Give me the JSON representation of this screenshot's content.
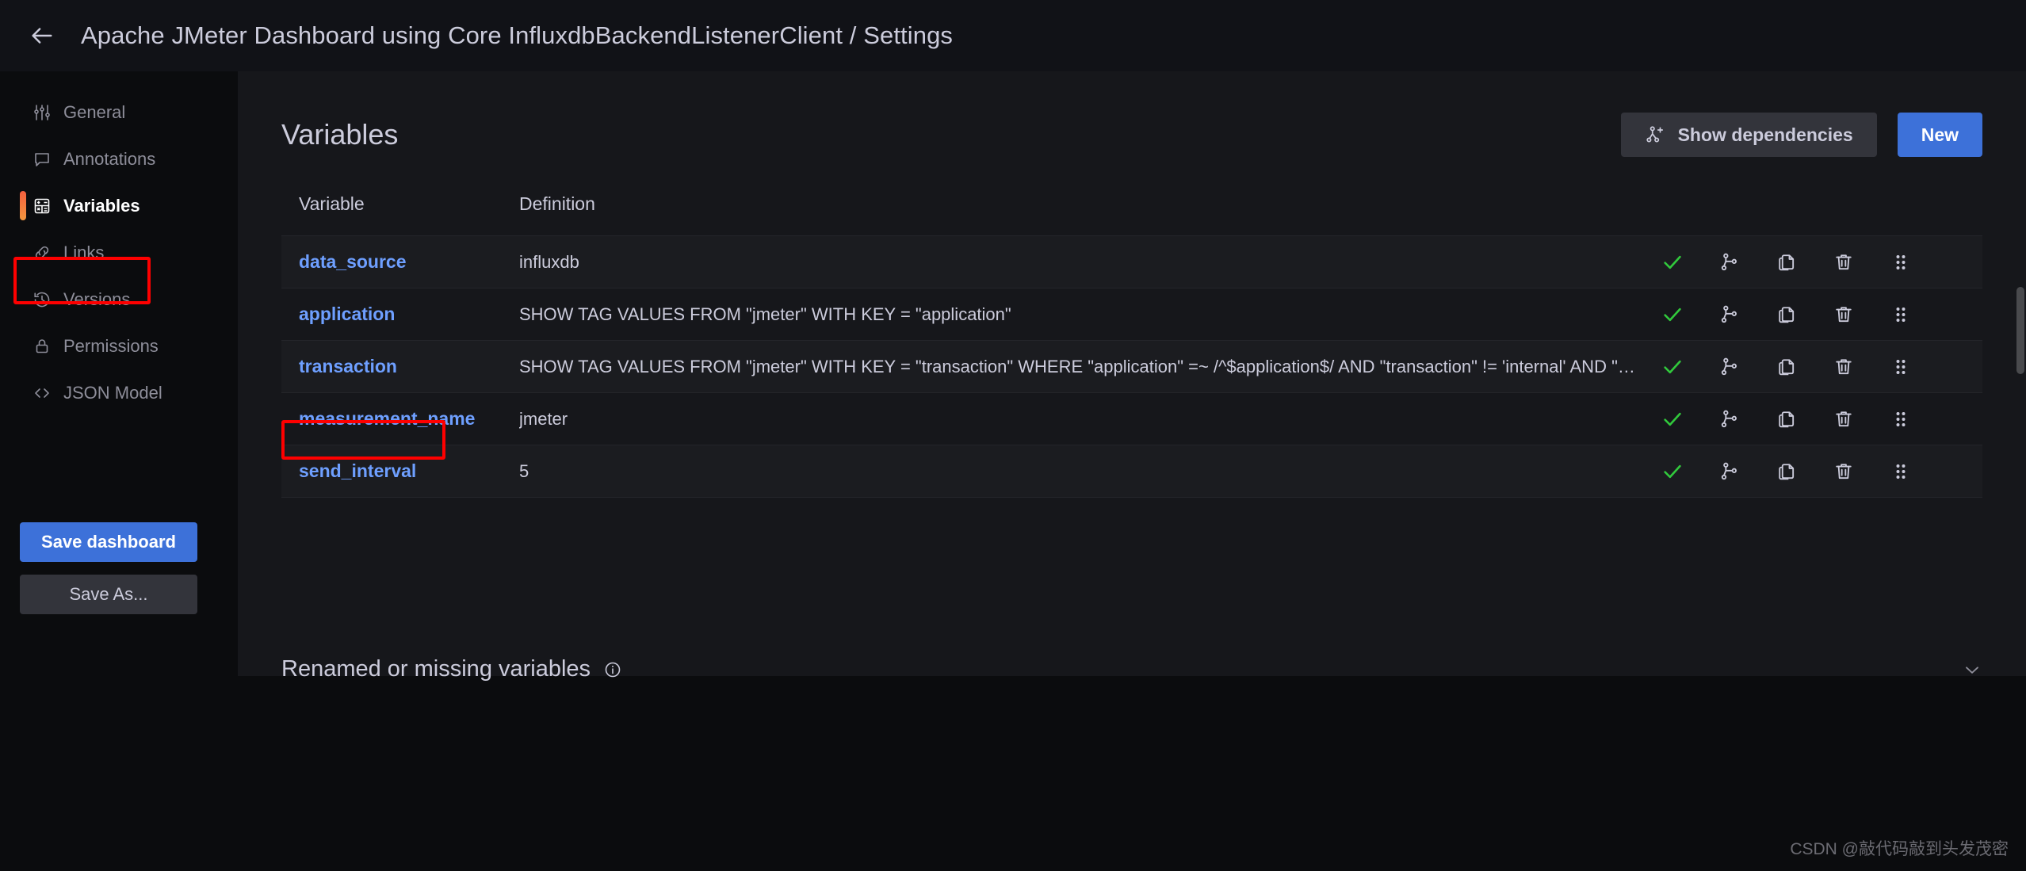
{
  "topbar": {
    "back_icon": "arrow-left-icon",
    "title": "Apache JMeter Dashboard using Core InfluxdbBackendListenerClient / Settings"
  },
  "sidebar": {
    "items": [
      {
        "label": "General",
        "icon": "sliders-icon",
        "active": false
      },
      {
        "label": "Annotations",
        "icon": "comment-icon",
        "active": false
      },
      {
        "label": "Variables",
        "icon": "calculator-icon",
        "active": true
      },
      {
        "label": "Links",
        "icon": "link-icon",
        "active": false
      },
      {
        "label": "Versions",
        "icon": "history-icon",
        "active": false
      },
      {
        "label": "Permissions",
        "icon": "lock-icon",
        "active": false
      },
      {
        "label": "JSON Model",
        "icon": "code-icon",
        "active": false
      }
    ],
    "save_dashboard_label": "Save dashboard",
    "save_as_label": "Save As..."
  },
  "main": {
    "title": "Variables",
    "show_dependencies_label": "Show dependencies",
    "new_label": "New",
    "table": {
      "columns": [
        "Variable",
        "Definition"
      ],
      "rows": [
        {
          "variable": "data_source",
          "definition": "influxdb"
        },
        {
          "variable": "application",
          "definition": "SHOW TAG VALUES FROM \"jmeter\" WITH KEY = \"application\""
        },
        {
          "variable": "transaction",
          "definition": "SHOW TAG VALUES FROM \"jmeter\" WITH KEY = \"transaction\" WHERE \"application\" =~ /^$application$/ AND \"transaction\" != 'internal' AND \"trans…"
        },
        {
          "variable": "measurement_name",
          "definition": "jmeter"
        },
        {
          "variable": "send_interval",
          "definition": "5"
        }
      ],
      "row_actions": [
        "check-icon",
        "dependency-graph-icon",
        "duplicate-icon",
        "trash-icon",
        "drag-handle-icon"
      ]
    },
    "renamed_section": {
      "title": "Renamed or missing variables",
      "info_icon": "info-circle-icon",
      "chevron_icon": "chevron-down-icon"
    }
  },
  "watermark": "CSDN @敲代码敲到头发茂密",
  "colors": {
    "accent_blue": "#3d71d9",
    "link_blue": "#6e9fff",
    "active_marker": "#f55f3e",
    "highlight_box": "#fe0000",
    "check_green": "#31c93c",
    "panel_bg": "#16171b",
    "page_bg": "#0b0c0e"
  }
}
